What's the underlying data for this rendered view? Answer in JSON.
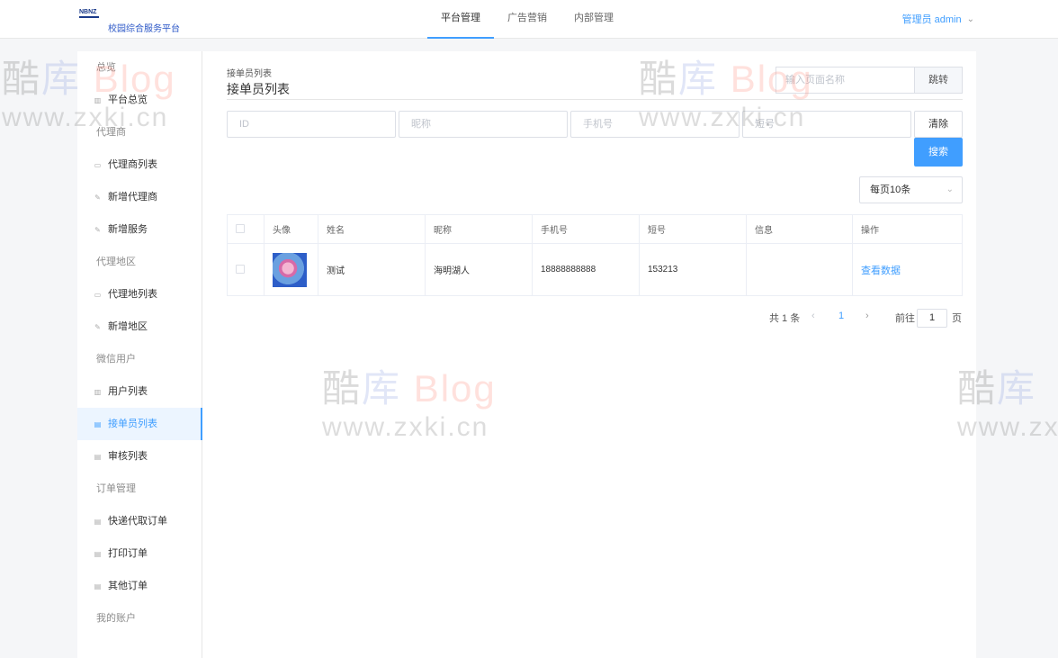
{
  "header": {
    "logo_mark": "NBNZ",
    "site_title": "校园综合服务平台",
    "nav": [
      "平台管理",
      "广告营销",
      "内部管理"
    ],
    "user": "管理员 admin"
  },
  "sidebar": {
    "groups": [
      {
        "title": "总览",
        "items": [
          "平台总览"
        ]
      },
      {
        "title": "代理商",
        "items": [
          "代理商列表",
          "新增代理商",
          "新增服务"
        ]
      },
      {
        "title": "代理地区",
        "items": [
          "代理地列表",
          "新增地区"
        ]
      },
      {
        "title": "微信用户",
        "items": [
          "用户列表",
          "接单员列表",
          "审核列表"
        ]
      },
      {
        "title": "订单管理",
        "items": [
          "快递代取订单",
          "打印订单",
          "其他订单"
        ]
      },
      {
        "title": "我的账户",
        "items": []
      }
    ],
    "active": "接单员列表"
  },
  "breadcrumb": {
    "small": "接单员列表",
    "title": "接单员列表"
  },
  "jump": {
    "placeholder": "输入页面名称",
    "button": "跳转"
  },
  "filters": {
    "id": "ID",
    "nickname": "昵称",
    "phone": "手机号",
    "short": "短号"
  },
  "buttons": {
    "clear": "清除",
    "search": "搜索"
  },
  "page_size": "每页10条",
  "table": {
    "headers": [
      "头像",
      "姓名",
      "昵称",
      "手机号",
      "短号",
      "信息",
      "操作"
    ],
    "rows": [
      {
        "name": "测试",
        "nickname": "海明湖人",
        "phone": "18888888888",
        "short": "153213",
        "info": "",
        "action": "查看数据"
      }
    ]
  },
  "pagination": {
    "total": "共 1 条",
    "current": "1",
    "goto": "前往",
    "goto_value": "1",
    "unit": "页"
  },
  "watermark": {
    "brand_1": "酷",
    "brand_2": "库",
    "brand_3": "Blog",
    "url": "www.zxki.cn"
  },
  "colors": {
    "accent": "#409eff"
  }
}
